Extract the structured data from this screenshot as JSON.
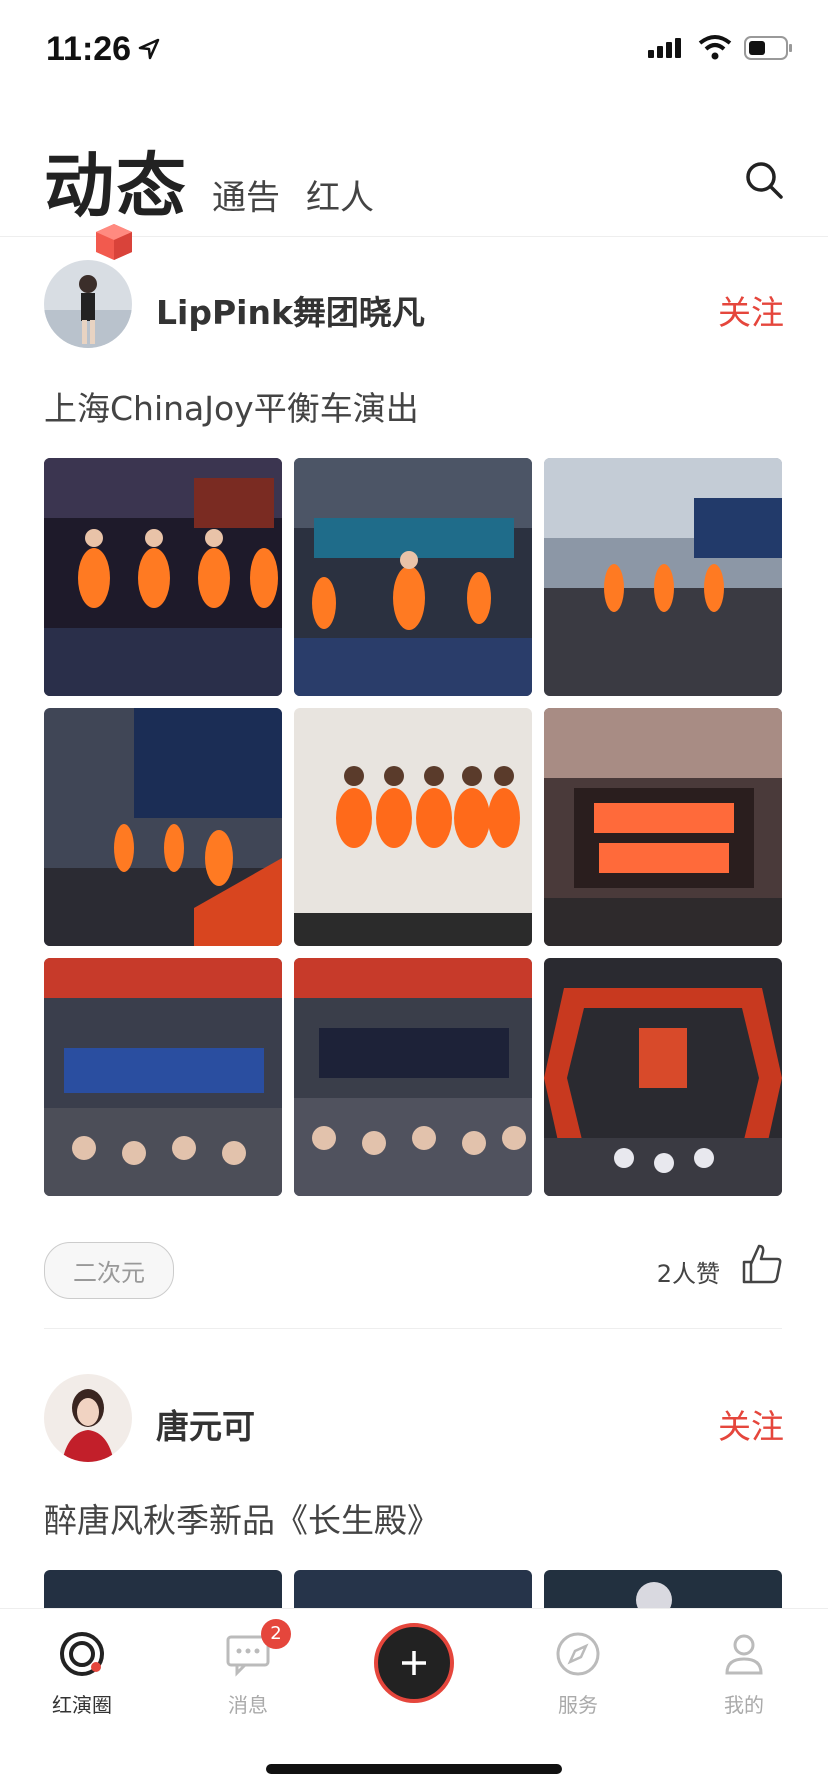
{
  "status_bar": {
    "time": "11:26"
  },
  "header": {
    "title": "动态",
    "tabs": [
      {
        "label": "通告"
      },
      {
        "label": "红人"
      }
    ]
  },
  "posts": [
    {
      "author": "LipPink舞团晓凡",
      "follow_label": "关注",
      "caption": "上海ChinaJoy平衡车演出",
      "photo_count": 9,
      "tag": "二次元",
      "likes": "2人赞"
    },
    {
      "author": "唐元可",
      "follow_label": "关注",
      "caption": "醉唐风秋季新品《长生殿》",
      "photo_count": 3
    }
  ],
  "bottom_nav": {
    "items": [
      {
        "label": "红演圈",
        "icon": "home-ring-icon",
        "active": true
      },
      {
        "label": "消息",
        "icon": "message-icon",
        "badge": "2"
      },
      {
        "label": "",
        "icon": "plus-icon"
      },
      {
        "label": "服务",
        "icon": "compass-icon"
      },
      {
        "label": "我的",
        "icon": "user-icon"
      }
    ]
  },
  "colors": {
    "accent": "#e5463c",
    "text": "#333333",
    "muted": "#aaaaaa"
  }
}
